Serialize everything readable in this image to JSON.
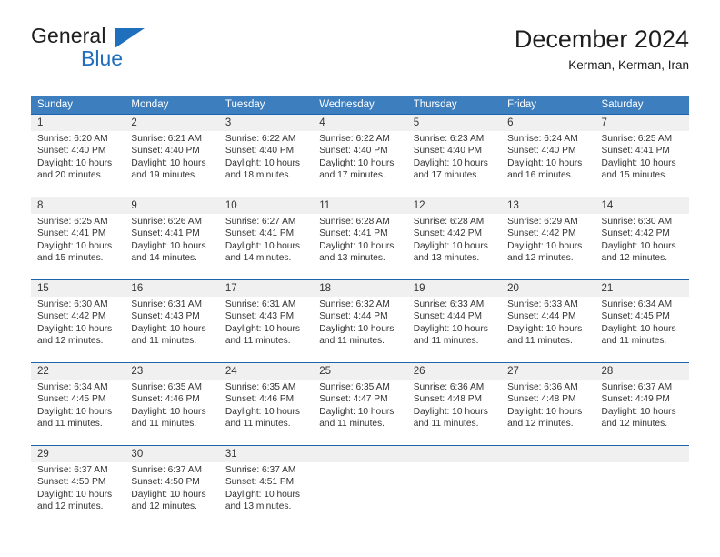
{
  "brand": {
    "name_part1": "General",
    "name_part2": "Blue",
    "logo_icon": "blue-triangle-icon"
  },
  "header": {
    "title": "December 2024",
    "subtitle": "Kerman, Kerman, Iran"
  },
  "colors": {
    "header_blue": "#3d7ebf",
    "row_divider_blue": "#1c64ad",
    "daynum_band_gray": "#f0f0f0",
    "brand_blue": "#1f6fbd",
    "text": "#333333"
  },
  "weekdays": [
    "Sunday",
    "Monday",
    "Tuesday",
    "Wednesday",
    "Thursday",
    "Friday",
    "Saturday"
  ],
  "weeks": [
    [
      {
        "day": "1",
        "sunrise": "Sunrise: 6:20 AM",
        "sunset": "Sunset: 4:40 PM",
        "daylight1": "Daylight: 10 hours",
        "daylight2": "and 20 minutes."
      },
      {
        "day": "2",
        "sunrise": "Sunrise: 6:21 AM",
        "sunset": "Sunset: 4:40 PM",
        "daylight1": "Daylight: 10 hours",
        "daylight2": "and 19 minutes."
      },
      {
        "day": "3",
        "sunrise": "Sunrise: 6:22 AM",
        "sunset": "Sunset: 4:40 PM",
        "daylight1": "Daylight: 10 hours",
        "daylight2": "and 18 minutes."
      },
      {
        "day": "4",
        "sunrise": "Sunrise: 6:22 AM",
        "sunset": "Sunset: 4:40 PM",
        "daylight1": "Daylight: 10 hours",
        "daylight2": "and 17 minutes."
      },
      {
        "day": "5",
        "sunrise": "Sunrise: 6:23 AM",
        "sunset": "Sunset: 4:40 PM",
        "daylight1": "Daylight: 10 hours",
        "daylight2": "and 17 minutes."
      },
      {
        "day": "6",
        "sunrise": "Sunrise: 6:24 AM",
        "sunset": "Sunset: 4:40 PM",
        "daylight1": "Daylight: 10 hours",
        "daylight2": "and 16 minutes."
      },
      {
        "day": "7",
        "sunrise": "Sunrise: 6:25 AM",
        "sunset": "Sunset: 4:41 PM",
        "daylight1": "Daylight: 10 hours",
        "daylight2": "and 15 minutes."
      }
    ],
    [
      {
        "day": "8",
        "sunrise": "Sunrise: 6:25 AM",
        "sunset": "Sunset: 4:41 PM",
        "daylight1": "Daylight: 10 hours",
        "daylight2": "and 15 minutes."
      },
      {
        "day": "9",
        "sunrise": "Sunrise: 6:26 AM",
        "sunset": "Sunset: 4:41 PM",
        "daylight1": "Daylight: 10 hours",
        "daylight2": "and 14 minutes."
      },
      {
        "day": "10",
        "sunrise": "Sunrise: 6:27 AM",
        "sunset": "Sunset: 4:41 PM",
        "daylight1": "Daylight: 10 hours",
        "daylight2": "and 14 minutes."
      },
      {
        "day": "11",
        "sunrise": "Sunrise: 6:28 AM",
        "sunset": "Sunset: 4:41 PM",
        "daylight1": "Daylight: 10 hours",
        "daylight2": "and 13 minutes."
      },
      {
        "day": "12",
        "sunrise": "Sunrise: 6:28 AM",
        "sunset": "Sunset: 4:42 PM",
        "daylight1": "Daylight: 10 hours",
        "daylight2": "and 13 minutes."
      },
      {
        "day": "13",
        "sunrise": "Sunrise: 6:29 AM",
        "sunset": "Sunset: 4:42 PM",
        "daylight1": "Daylight: 10 hours",
        "daylight2": "and 12 minutes."
      },
      {
        "day": "14",
        "sunrise": "Sunrise: 6:30 AM",
        "sunset": "Sunset: 4:42 PM",
        "daylight1": "Daylight: 10 hours",
        "daylight2": "and 12 minutes."
      }
    ],
    [
      {
        "day": "15",
        "sunrise": "Sunrise: 6:30 AM",
        "sunset": "Sunset: 4:42 PM",
        "daylight1": "Daylight: 10 hours",
        "daylight2": "and 12 minutes."
      },
      {
        "day": "16",
        "sunrise": "Sunrise: 6:31 AM",
        "sunset": "Sunset: 4:43 PM",
        "daylight1": "Daylight: 10 hours",
        "daylight2": "and 11 minutes."
      },
      {
        "day": "17",
        "sunrise": "Sunrise: 6:31 AM",
        "sunset": "Sunset: 4:43 PM",
        "daylight1": "Daylight: 10 hours",
        "daylight2": "and 11 minutes."
      },
      {
        "day": "18",
        "sunrise": "Sunrise: 6:32 AM",
        "sunset": "Sunset: 4:44 PM",
        "daylight1": "Daylight: 10 hours",
        "daylight2": "and 11 minutes."
      },
      {
        "day": "19",
        "sunrise": "Sunrise: 6:33 AM",
        "sunset": "Sunset: 4:44 PM",
        "daylight1": "Daylight: 10 hours",
        "daylight2": "and 11 minutes."
      },
      {
        "day": "20",
        "sunrise": "Sunrise: 6:33 AM",
        "sunset": "Sunset: 4:44 PM",
        "daylight1": "Daylight: 10 hours",
        "daylight2": "and 11 minutes."
      },
      {
        "day": "21",
        "sunrise": "Sunrise: 6:34 AM",
        "sunset": "Sunset: 4:45 PM",
        "daylight1": "Daylight: 10 hours",
        "daylight2": "and 11 minutes."
      }
    ],
    [
      {
        "day": "22",
        "sunrise": "Sunrise: 6:34 AM",
        "sunset": "Sunset: 4:45 PM",
        "daylight1": "Daylight: 10 hours",
        "daylight2": "and 11 minutes."
      },
      {
        "day": "23",
        "sunrise": "Sunrise: 6:35 AM",
        "sunset": "Sunset: 4:46 PM",
        "daylight1": "Daylight: 10 hours",
        "daylight2": "and 11 minutes."
      },
      {
        "day": "24",
        "sunrise": "Sunrise: 6:35 AM",
        "sunset": "Sunset: 4:46 PM",
        "daylight1": "Daylight: 10 hours",
        "daylight2": "and 11 minutes."
      },
      {
        "day": "25",
        "sunrise": "Sunrise: 6:35 AM",
        "sunset": "Sunset: 4:47 PM",
        "daylight1": "Daylight: 10 hours",
        "daylight2": "and 11 minutes."
      },
      {
        "day": "26",
        "sunrise": "Sunrise: 6:36 AM",
        "sunset": "Sunset: 4:48 PM",
        "daylight1": "Daylight: 10 hours",
        "daylight2": "and 11 minutes."
      },
      {
        "day": "27",
        "sunrise": "Sunrise: 6:36 AM",
        "sunset": "Sunset: 4:48 PM",
        "daylight1": "Daylight: 10 hours",
        "daylight2": "and 12 minutes."
      },
      {
        "day": "28",
        "sunrise": "Sunrise: 6:37 AM",
        "sunset": "Sunset: 4:49 PM",
        "daylight1": "Daylight: 10 hours",
        "daylight2": "and 12 minutes."
      }
    ],
    [
      {
        "day": "29",
        "sunrise": "Sunrise: 6:37 AM",
        "sunset": "Sunset: 4:50 PM",
        "daylight1": "Daylight: 10 hours",
        "daylight2": "and 12 minutes."
      },
      {
        "day": "30",
        "sunrise": "Sunrise: 6:37 AM",
        "sunset": "Sunset: 4:50 PM",
        "daylight1": "Daylight: 10 hours",
        "daylight2": "and 12 minutes."
      },
      {
        "day": "31",
        "sunrise": "Sunrise: 6:37 AM",
        "sunset": "Sunset: 4:51 PM",
        "daylight1": "Daylight: 10 hours",
        "daylight2": "and 13 minutes."
      },
      {
        "day": "",
        "sunrise": "",
        "sunset": "",
        "daylight1": "",
        "daylight2": ""
      },
      {
        "day": "",
        "sunrise": "",
        "sunset": "",
        "daylight1": "",
        "daylight2": ""
      },
      {
        "day": "",
        "sunrise": "",
        "sunset": "",
        "daylight1": "",
        "daylight2": ""
      },
      {
        "day": "",
        "sunrise": "",
        "sunset": "",
        "daylight1": "",
        "daylight2": ""
      }
    ]
  ]
}
